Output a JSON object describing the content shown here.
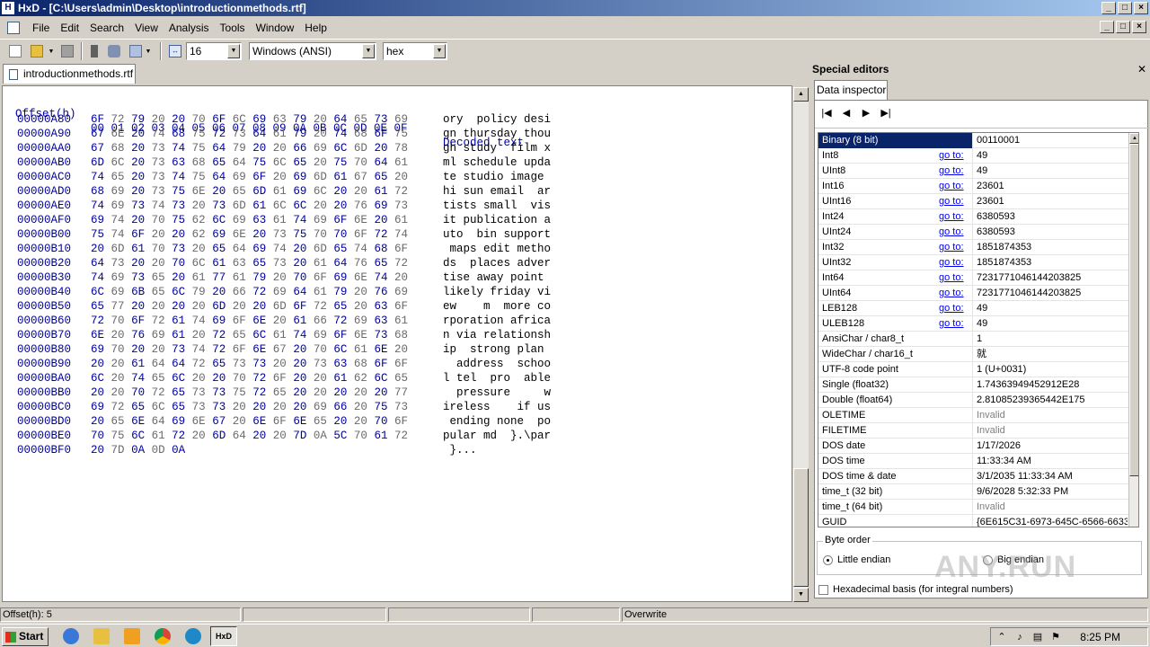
{
  "window": {
    "title": "HxD - [C:\\Users\\admin\\Desktop\\introductionmethods.rtf]"
  },
  "menu": [
    "File",
    "Edit",
    "Search",
    "View",
    "Analysis",
    "Tools",
    "Window",
    "Help"
  ],
  "toolbar": {
    "bytes_per_row": "16",
    "charset": "Windows (ANSI)",
    "offset_base": "hex"
  },
  "editor": {
    "tab_label": "introductionmethods.rtf",
    "header": {
      "offset": "Offset(h)",
      "columns": "00 01 02 03 04 05 06 07 08 09 0A 0B 0C 0D 0E 0F",
      "decoded": "Decoded text"
    },
    "rows": [
      {
        "offset": "00000A80",
        "bytes": [
          "6F",
          "72",
          "79",
          "20",
          "20",
          "70",
          "6F",
          "6C",
          "69",
          "63",
          "79",
          "20",
          "64",
          "65",
          "73",
          "69"
        ],
        "text": "ory  policy desi"
      },
      {
        "offset": "00000A90",
        "bytes": [
          "67",
          "6E",
          "20",
          "74",
          "68",
          "75",
          "72",
          "73",
          "64",
          "61",
          "79",
          "20",
          "74",
          "68",
          "6F",
          "75"
        ],
        "text": "gn thursday thou"
      },
      {
        "offset": "00000AA0",
        "bytes": [
          "67",
          "68",
          "20",
          "73",
          "74",
          "75",
          "64",
          "79",
          "20",
          "20",
          "66",
          "69",
          "6C",
          "6D",
          "20",
          "78"
        ],
        "text": "gh study  film x"
      },
      {
        "offset": "00000AB0",
        "bytes": [
          "6D",
          "6C",
          "20",
          "73",
          "63",
          "68",
          "65",
          "64",
          "75",
          "6C",
          "65",
          "20",
          "75",
          "70",
          "64",
          "61"
        ],
        "text": "ml schedule upda"
      },
      {
        "offset": "00000AC0",
        "bytes": [
          "74",
          "65",
          "20",
          "73",
          "74",
          "75",
          "64",
          "69",
          "6F",
          "20",
          "69",
          "6D",
          "61",
          "67",
          "65",
          "20"
        ],
        "text": "te studio image "
      },
      {
        "offset": "00000AD0",
        "bytes": [
          "68",
          "69",
          "20",
          "73",
          "75",
          "6E",
          "20",
          "65",
          "6D",
          "61",
          "69",
          "6C",
          "20",
          "20",
          "61",
          "72"
        ],
        "text": "hi sun email  ar"
      },
      {
        "offset": "00000AE0",
        "bytes": [
          "74",
          "69",
          "73",
          "74",
          "73",
          "20",
          "73",
          "6D",
          "61",
          "6C",
          "6C",
          "20",
          "20",
          "76",
          "69",
          "73"
        ],
        "text": "tists small  vis"
      },
      {
        "offset": "00000AF0",
        "bytes": [
          "69",
          "74",
          "20",
          "70",
          "75",
          "62",
          "6C",
          "69",
          "63",
          "61",
          "74",
          "69",
          "6F",
          "6E",
          "20",
          "61"
        ],
        "text": "it publication a"
      },
      {
        "offset": "00000B00",
        "bytes": [
          "75",
          "74",
          "6F",
          "20",
          "20",
          "62",
          "69",
          "6E",
          "20",
          "73",
          "75",
          "70",
          "70",
          "6F",
          "72",
          "74"
        ],
        "text": "uto  bin support"
      },
      {
        "offset": "00000B10",
        "bytes": [
          "20",
          "6D",
          "61",
          "70",
          "73",
          "20",
          "65",
          "64",
          "69",
          "74",
          "20",
          "6D",
          "65",
          "74",
          "68",
          "6F"
        ],
        "text": " maps edit metho"
      },
      {
        "offset": "00000B20",
        "bytes": [
          "64",
          "73",
          "20",
          "20",
          "70",
          "6C",
          "61",
          "63",
          "65",
          "73",
          "20",
          "61",
          "64",
          "76",
          "65",
          "72"
        ],
        "text": "ds  places adver"
      },
      {
        "offset": "00000B30",
        "bytes": [
          "74",
          "69",
          "73",
          "65",
          "20",
          "61",
          "77",
          "61",
          "79",
          "20",
          "70",
          "6F",
          "69",
          "6E",
          "74",
          "20"
        ],
        "text": "tise away point "
      },
      {
        "offset": "00000B40",
        "bytes": [
          "6C",
          "69",
          "6B",
          "65",
          "6C",
          "79",
          "20",
          "66",
          "72",
          "69",
          "64",
          "61",
          "79",
          "20",
          "76",
          "69"
        ],
        "text": "likely friday vi"
      },
      {
        "offset": "00000B50",
        "bytes": [
          "65",
          "77",
          "20",
          "20",
          "20",
          "20",
          "6D",
          "20",
          "20",
          "6D",
          "6F",
          "72",
          "65",
          "20",
          "63",
          "6F"
        ],
        "text": "ew    m  more co"
      },
      {
        "offset": "00000B60",
        "bytes": [
          "72",
          "70",
          "6F",
          "72",
          "61",
          "74",
          "69",
          "6F",
          "6E",
          "20",
          "61",
          "66",
          "72",
          "69",
          "63",
          "61"
        ],
        "text": "rporation africa"
      },
      {
        "offset": "00000B70",
        "bytes": [
          "6E",
          "20",
          "76",
          "69",
          "61",
          "20",
          "72",
          "65",
          "6C",
          "61",
          "74",
          "69",
          "6F",
          "6E",
          "73",
          "68"
        ],
        "text": "n via relationsh"
      },
      {
        "offset": "00000B80",
        "bytes": [
          "69",
          "70",
          "20",
          "20",
          "73",
          "74",
          "72",
          "6F",
          "6E",
          "67",
          "20",
          "70",
          "6C",
          "61",
          "6E",
          "20"
        ],
        "text": "ip  strong plan "
      },
      {
        "offset": "00000B90",
        "bytes": [
          "20",
          "20",
          "61",
          "64",
          "64",
          "72",
          "65",
          "73",
          "73",
          "20",
          "20",
          "73",
          "63",
          "68",
          "6F",
          "6F"
        ],
        "text": "  address  schoo"
      },
      {
        "offset": "00000BA0",
        "bytes": [
          "6C",
          "20",
          "74",
          "65",
          "6C",
          "20",
          "20",
          "70",
          "72",
          "6F",
          "20",
          "20",
          "61",
          "62",
          "6C",
          "65"
        ],
        "text": "l tel  pro  able"
      },
      {
        "offset": "00000BB0",
        "bytes": [
          "20",
          "20",
          "70",
          "72",
          "65",
          "73",
          "73",
          "75",
          "72",
          "65",
          "20",
          "20",
          "20",
          "20",
          "20",
          "77"
        ],
        "text": "  pressure     w"
      },
      {
        "offset": "00000BC0",
        "bytes": [
          "69",
          "72",
          "65",
          "6C",
          "65",
          "73",
          "73",
          "20",
          "20",
          "20",
          "20",
          "69",
          "66",
          "20",
          "75",
          "73"
        ],
        "text": "ireless    if us"
      },
      {
        "offset": "00000BD0",
        "bytes": [
          "20",
          "65",
          "6E",
          "64",
          "69",
          "6E",
          "67",
          "20",
          "6E",
          "6F",
          "6E",
          "65",
          "20",
          "20",
          "70",
          "6F"
        ],
        "text": " ending none  po"
      },
      {
        "offset": "00000BE0",
        "bytes": [
          "70",
          "75",
          "6C",
          "61",
          "72",
          "20",
          "6D",
          "64",
          "20",
          "20",
          "7D",
          "0A",
          "5C",
          "70",
          "61",
          "72"
        ],
        "text": "pular md  }.\\par"
      },
      {
        "offset": "00000BF0",
        "bytes": [
          "20",
          "7D",
          "0A",
          "0D",
          "0A"
        ],
        "text": " }..."
      }
    ]
  },
  "inspector": {
    "panel_title": "Special editors",
    "tab_label": "Data inspector",
    "goto_label": "go to:",
    "rows": [
      {
        "name": "Binary (8 bit)",
        "value": "00110001",
        "goto": false,
        "selected": true
      },
      {
        "name": "Int8",
        "value": "49",
        "goto": true
      },
      {
        "name": "UInt8",
        "value": "49",
        "goto": true
      },
      {
        "name": "Int16",
        "value": "23601",
        "goto": true
      },
      {
        "name": "UInt16",
        "value": "23601",
        "goto": true
      },
      {
        "name": "Int24",
        "value": "6380593",
        "goto": true
      },
      {
        "name": "UInt24",
        "value": "6380593",
        "goto": true
      },
      {
        "name": "Int32",
        "value": "1851874353",
        "goto": true
      },
      {
        "name": "UInt32",
        "value": "1851874353",
        "goto": true
      },
      {
        "name": "Int64",
        "value": "7231771046144203825",
        "goto": true
      },
      {
        "name": "UInt64",
        "value": "7231771046144203825",
        "goto": true
      },
      {
        "name": "LEB128",
        "value": "49",
        "goto": true
      },
      {
        "name": "ULEB128",
        "value": "49",
        "goto": true
      },
      {
        "name": "AnsiChar / char8_t",
        "value": "1",
        "goto": false
      },
      {
        "name": "WideChar / char16_t",
        "value": "就",
        "goto": false
      },
      {
        "name": "UTF-8 code point",
        "value": "1 (U+0031)",
        "goto": false
      },
      {
        "name": "Single (float32)",
        "value": "1.74363949452912E28",
        "goto": false
      },
      {
        "name": "Double (float64)",
        "value": "2.81085239365442E175",
        "goto": false
      },
      {
        "name": "OLETIME",
        "value": "Invalid",
        "goto": false,
        "invalid": true
      },
      {
        "name": "FILETIME",
        "value": "Invalid",
        "goto": false,
        "invalid": true
      },
      {
        "name": "DOS date",
        "value": "1/17/2026",
        "goto": false
      },
      {
        "name": "DOS time",
        "value": "11:33:34 AM",
        "goto": false
      },
      {
        "name": "DOS time & date",
        "value": "3/1/2035 11:33:34 AM",
        "goto": false
      },
      {
        "name": "time_t (32 bit)",
        "value": "9/6/2028 5:32:33 PM",
        "goto": false
      },
      {
        "name": "time_t (64 bit)",
        "value": "Invalid",
        "goto": false,
        "invalid": true
      },
      {
        "name": "GUID",
        "value": "{6E615C31-6973-645C-6566-6633",
        "goto": false
      }
    ],
    "byte_order_label": "Byte order",
    "little_endian": "Little endian",
    "big_endian": "Big endian",
    "hex_basis": "Hexadecimal basis (for integral numbers)"
  },
  "status": {
    "offset": "Offset(h): 5",
    "mode": "Overwrite"
  },
  "taskbar": {
    "start": "Start",
    "task_label": "HxD",
    "clock": "8:25 PM"
  },
  "watermark": "ANY.RUN",
  "colors": {
    "title_gradient_start": "#0a246a",
    "title_gradient_end": "#a6caf0",
    "hex_blue": "#0000a0",
    "selection": "#0a246a",
    "link": "#0000ff"
  }
}
